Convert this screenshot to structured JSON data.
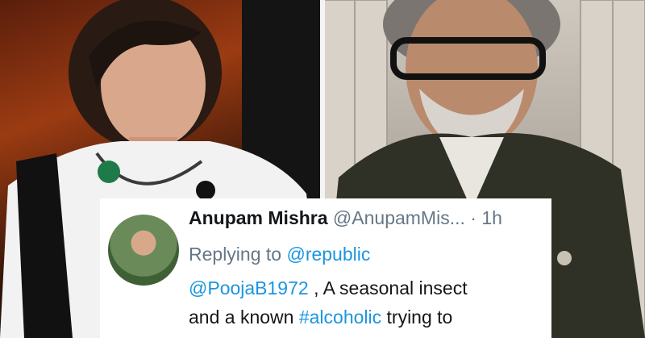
{
  "tweet": {
    "name": "Anupam Mishra",
    "handle": "@AnupamMis...",
    "dot": "·",
    "time": "1h",
    "reply_prefix": "Replying to",
    "reply_to": "@republic",
    "mention": "@PoojaB1972",
    "line1_rest": " ,  A seasonal insect",
    "line2_start": "and a known ",
    "hashtag": "#alcoholic",
    "line2_end": " trying to"
  },
  "colors": {
    "link": "#1b95e0",
    "muted": "#657786",
    "text": "#14171a"
  }
}
